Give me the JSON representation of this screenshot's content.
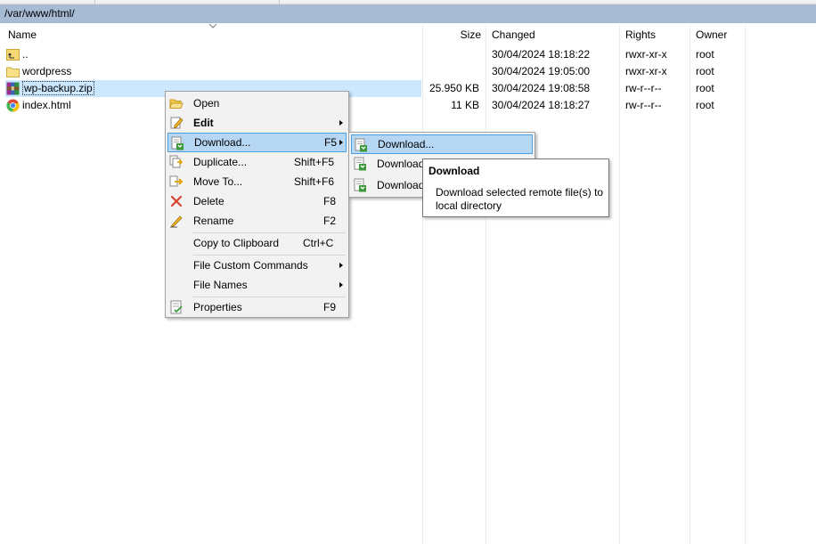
{
  "path_bar": {
    "path": "/var/www/html/"
  },
  "columns": {
    "name": "Name",
    "size": "Size",
    "changed": "Changed",
    "rights": "Rights",
    "owner": "Owner"
  },
  "rows": [
    {
      "name": "..",
      "size": "",
      "changed": "30/04/2024 18:18:22",
      "rights": "rwxr-xr-x",
      "owner": "root",
      "icon": "parent-folder-icon"
    },
    {
      "name": "wordpress",
      "size": "",
      "changed": "30/04/2024 19:05:00",
      "rights": "rwxr-xr-x",
      "owner": "root",
      "icon": "folder-icon"
    },
    {
      "name": "wp-backup.zip",
      "size": "25.950 KB",
      "changed": "30/04/2024 19:08:58",
      "rights": "rw-r--r--",
      "owner": "root",
      "icon": "archive-icon"
    },
    {
      "name": "index.html",
      "size": "11 KB",
      "changed": "30/04/2024 18:18:27",
      "rights": "rw-r--r--",
      "owner": "root",
      "icon": "chrome-icon"
    }
  ],
  "context_menu": {
    "items": [
      {
        "label": "Open",
        "shortcut": "",
        "icon": "open-folder-icon"
      },
      {
        "label": "Edit",
        "shortcut": "",
        "icon": "edit-icon"
      },
      {
        "label": "Download...",
        "shortcut": "F5",
        "icon": "download-icon"
      },
      {
        "label": "Duplicate...",
        "shortcut": "Shift+F5",
        "icon": "duplicate-icon"
      },
      {
        "label": "Move To...",
        "shortcut": "Shift+F6",
        "icon": "move-icon"
      },
      {
        "label": "Delete",
        "shortcut": "F8",
        "icon": "delete-icon"
      },
      {
        "label": "Rename",
        "shortcut": "F2",
        "icon": "rename-icon"
      },
      {
        "label": "Copy to Clipboard",
        "shortcut": "Ctrl+C",
        "icon": ""
      },
      {
        "label": "File Custom Commands",
        "shortcut": "",
        "icon": ""
      },
      {
        "label": "File Names",
        "shortcut": "",
        "icon": ""
      },
      {
        "label": "Properties",
        "shortcut": "F9",
        "icon": "properties-icon"
      }
    ]
  },
  "submenu": {
    "items": [
      {
        "label": "Download...",
        "icon": "download-icon"
      },
      {
        "label": "Download",
        "icon": "download-icon"
      },
      {
        "label": "Download",
        "icon": "download-icon"
      }
    ]
  },
  "tooltip": {
    "title": "Download",
    "body": "Download selected remote file(s) to local directory"
  },
  "colors": {
    "path_bar": "#a7bcd4",
    "selection": "#cce8ff",
    "menu_highlight": "#b5d7f3",
    "menu_highlight_border": "#4b9fe0",
    "delete_red": "#d9432f"
  }
}
